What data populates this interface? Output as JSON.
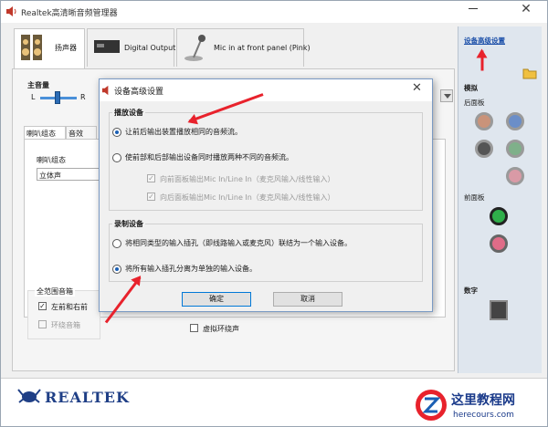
{
  "window": {
    "title": "Realtek高清晰音频管理器"
  },
  "tabs": [
    {
      "label": "扬声器"
    },
    {
      "label": "Digital Output"
    },
    {
      "label": "Mic in at front panel (Pink)"
    }
  ],
  "main_volume": {
    "label": "主音量",
    "left": "L",
    "right": "R"
  },
  "sub_tabs": [
    {
      "label": "喇叭组态"
    },
    {
      "label": "音效"
    }
  ],
  "speaker_config": {
    "label": "喇叭组态",
    "selected": "立体声"
  },
  "full_range": {
    "label": "全范围音箱",
    "opt1": "左前和右前",
    "opt2": "环绕音箱"
  },
  "virtual_surround": {
    "label": "虚拟环绕声"
  },
  "side_panel": {
    "advanced_link": "设备高级设置",
    "analog_label": "模拟",
    "rear_label": "后面板",
    "front_label": "前面板",
    "digital_label": "数字"
  },
  "brand": {
    "name": "REALTEK"
  },
  "dialog": {
    "title": "设备高级设置",
    "playback": {
      "title": "播放设备",
      "option1": "让前后输出装置播放相同的音频流。",
      "option2": "使前部和后部输出设备同时播放两种不同的音频流。",
      "check1": "向前面板输出Mic In/Line In（麦克风输入/线性输入）",
      "check2": "向后面板输出Mic In/Line In（麦克风输入/线性输入）"
    },
    "recording": {
      "title": "录制设备",
      "option1": "将相同类型的输入插孔（即线路输入或麦克风）联结为一个输入设备。",
      "option2": "将所有输入插孔分离为单独的输入设备。"
    },
    "ok": "确定",
    "cancel": "取消"
  },
  "watermark": {
    "title": "这里教程网",
    "url": "herecours.com"
  },
  "colors": {
    "accent": "#1a5fb4",
    "arrow": "#e8222c",
    "brand": "#1f3f86"
  }
}
